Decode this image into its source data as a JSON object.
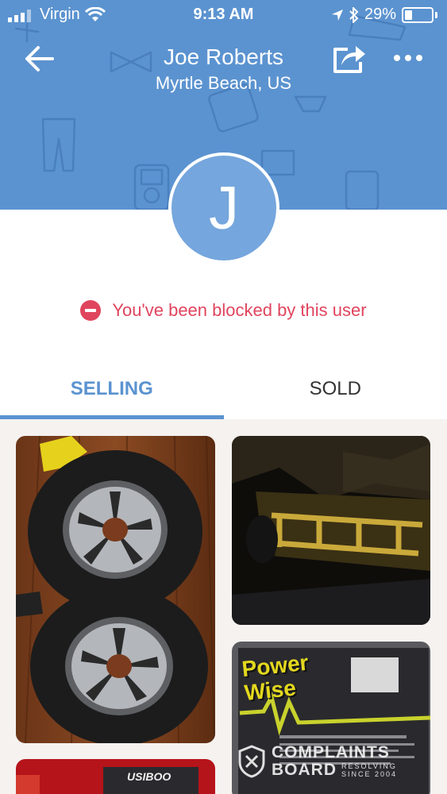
{
  "status_bar": {
    "carrier": "Virgin",
    "time": "9:13 AM",
    "battery_percent": "29%",
    "battery_level": 0.29
  },
  "header": {
    "name": "Joe Roberts",
    "location": "Myrtle Beach, US",
    "back_icon": "arrow-left-icon",
    "share_icon": "share-icon",
    "more_icon": "more-horizontal-icon"
  },
  "avatar": {
    "initial": "J"
  },
  "blocked": {
    "message": "You've been blocked by this user",
    "icon": "no-entry-icon"
  },
  "tabs": [
    {
      "label": "SELLING",
      "active": true
    },
    {
      "label": "SOLD",
      "active": false
    }
  ],
  "listings": [
    {
      "name": "wheels-and-tires-photo",
      "label_on_photo": ""
    },
    {
      "name": "utility-trailer-photo",
      "label_on_photo": ""
    },
    {
      "name": "powerwise-charger-photo",
      "label_on_photo": "Power Wise"
    },
    {
      "name": "red-item-photo",
      "label_on_photo": "USIBOO"
    }
  ],
  "watermark": {
    "line1": "COMPLAINTS",
    "line2": "BOARD",
    "line3a": "RESOLVING",
    "line3b": "SINCE 2004"
  },
  "colors": {
    "header_blue": "#5b93d0",
    "avatar_blue": "#75a6dd",
    "blocked_red": "#e0455e",
    "grid_bg": "#f5f2f0"
  }
}
